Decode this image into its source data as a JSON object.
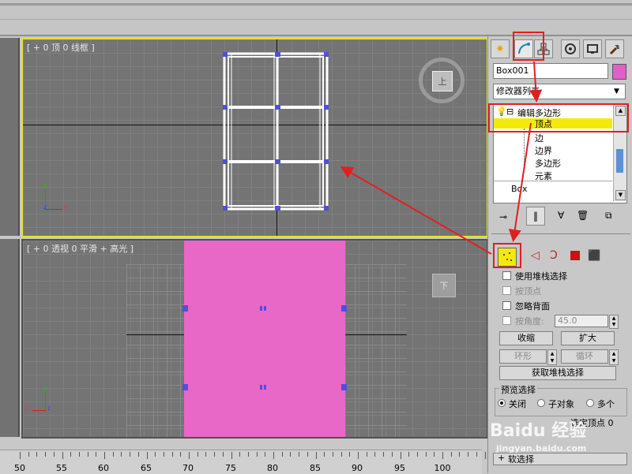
{
  "viewports": {
    "top_label": "[ + 0 顶 0 线框 ]",
    "persp_label": "[ + 0 透视 0 平滑 + 高光 ]",
    "viewcube_top": "上",
    "viewcube_bottom": "下",
    "axis_y": "y",
    "axis_z": "z",
    "axis_x": "x"
  },
  "ruler": {
    "labels": [
      "50",
      "55",
      "60",
      "65",
      "70",
      "75",
      "80",
      "85",
      "90",
      "95",
      "100"
    ]
  },
  "panel": {
    "object_name": "Box001",
    "modifier_list": "修改器列表",
    "stack": {
      "root": "编辑多边形",
      "items": [
        "顶点",
        "边",
        "边界",
        "多边形",
        "元素"
      ],
      "base": "Box"
    },
    "selection": {
      "use_stack": "使用堆栈选择",
      "by_vertex": "按顶点",
      "ignore_backface": "忽略背面",
      "by_angle": "按角度:",
      "angle_value": "45.0",
      "shrink": "收缩",
      "grow": "扩大",
      "ring": "环形",
      "loop": "循环",
      "get_stack": "获取堆栈选择"
    },
    "preview": {
      "title": "预览选择",
      "off": "关闭",
      "subobj": "子对象",
      "multi": "多个"
    },
    "selected_count": "选定顶点 0",
    "soft_selection": "软选择"
  },
  "watermark": {
    "brand": "Baidu 经验",
    "url": "jingyan.baidu.com"
  },
  "colors": {
    "box_fill": "#e868c8",
    "vertex": "#5050d8",
    "highlight": "#f5e90c",
    "annotation": "#e02020",
    "active_border": "#e6e030"
  }
}
